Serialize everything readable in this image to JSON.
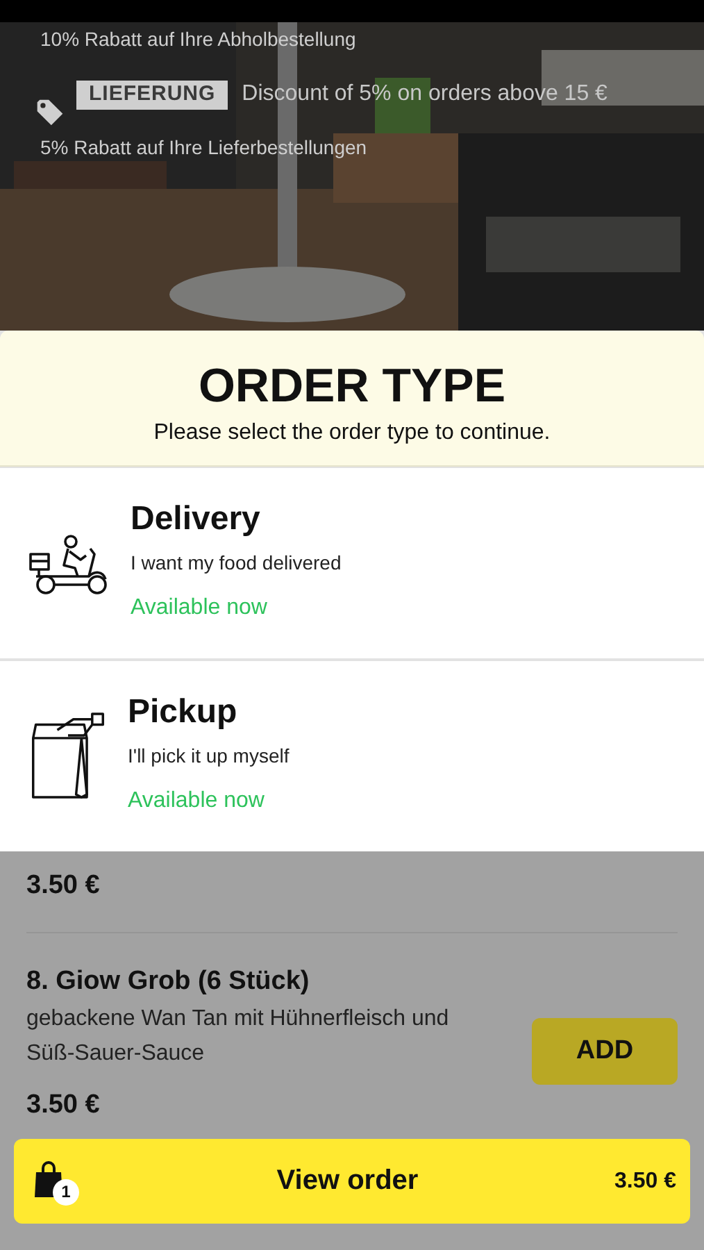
{
  "promo": {
    "pickup_detail": "10% Rabatt auf Ihre Abholbestellung",
    "delivery_badge": "LIEFERUNG",
    "delivery_title": "Discount of 5% on orders above 15 €",
    "delivery_detail": "5% Rabatt auf Ihre Lieferbestellungen"
  },
  "order_type": {
    "title": "ORDER TYPE",
    "subtitle": "Please select the order type to continue.",
    "options": [
      {
        "kind": "delivery",
        "title": "Delivery",
        "description": "I want my food delivered",
        "availability": "Available now"
      },
      {
        "kind": "pickup",
        "title": "Pickup",
        "description": "I'll pick it up myself",
        "availability": "Available now"
      }
    ]
  },
  "menu_items": [
    {
      "price": "3.50 €"
    },
    {
      "name": "8. Giow Grob (6 Stück)",
      "description": "gebackene Wan Tan mit Hühnerfleisch und Süß-Sauer-Sauce",
      "price": "3.50 €",
      "button": "ADD"
    }
  ],
  "cart": {
    "count": "1",
    "label": "View order",
    "total": "3.50 €"
  }
}
